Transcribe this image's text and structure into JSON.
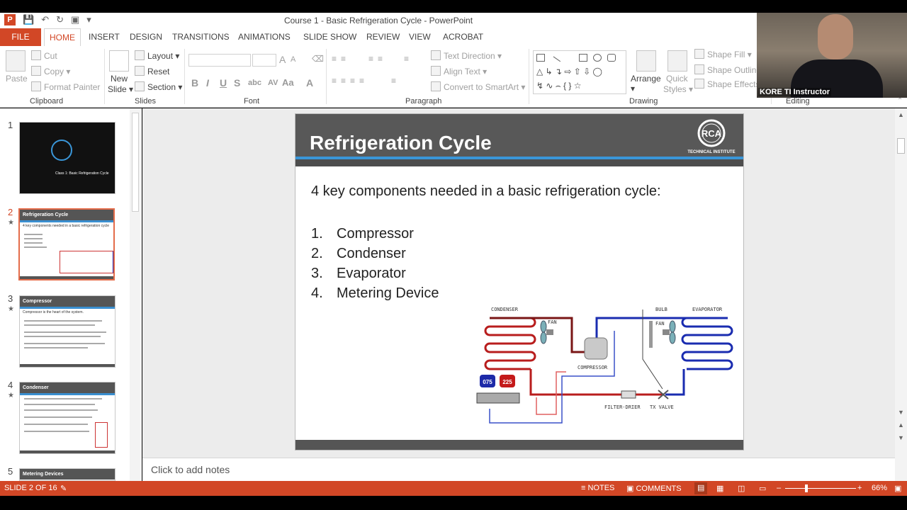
{
  "window": {
    "title": "Course 1 - Basic Refrigeration Cycle - PowerPoint"
  },
  "tabs": [
    "FILE",
    "HOME",
    "INSERT",
    "DESIGN",
    "TRANSITIONS",
    "ANIMATIONS",
    "SLIDE SHOW",
    "REVIEW",
    "VIEW",
    "ACROBAT"
  ],
  "ribbon": {
    "clipboard": {
      "paste": "Paste",
      "cut": "Cut",
      "copy": "Copy",
      "format_painter": "Format Painter",
      "label": "Clipboard"
    },
    "slides": {
      "new_slide_line1": "New",
      "new_slide_line2": "Slide",
      "layout": "Layout",
      "reset": "Reset",
      "section": "Section",
      "label": "Slides"
    },
    "font": {
      "label": "Font",
      "bold": "B",
      "italic": "I",
      "underline": "U",
      "strike": "S",
      "shadow": "abc",
      "spacing": "AV",
      "case": "Aa",
      "color": "A",
      "grow": "A",
      "shrink": "A"
    },
    "paragraph": {
      "label": "Paragraph",
      "text_direction": "Text Direction",
      "align_text": "Align Text",
      "convert_smartart": "Convert to SmartArt"
    },
    "drawing": {
      "label": "Drawing",
      "arrange": "Arrange",
      "quick_styles_1": "Quick",
      "quick_styles_2": "Styles",
      "shape_fill": "Shape Fill",
      "shape_outline": "Shape Outline",
      "shape_effects": "Shape Effects"
    },
    "editing": {
      "label": "Editing"
    }
  },
  "webcam": {
    "label": "KORE TI Instructor"
  },
  "thumbnails": [
    {
      "num": "1",
      "title": "",
      "subtitle": "Class 1: Basic Refrigeration Cycle",
      "star": false
    },
    {
      "num": "2",
      "title": "Refrigeration Cycle",
      "subtitle": "4 key components needed in a basic refrigeration cycle",
      "star": true
    },
    {
      "num": "3",
      "title": "Compressor",
      "subtitle": "Compressor is the heart of the system.",
      "star": true
    },
    {
      "num": "4",
      "title": "Condenser",
      "subtitle": "",
      "star": true
    },
    {
      "num": "5",
      "title": "Metering Devices",
      "subtitle": "",
      "star": false
    }
  ],
  "slide": {
    "title": "Refrigeration Cycle",
    "logo": {
      "text": "RCA",
      "sub": "TECHNICAL INSTITUTE"
    },
    "intro": "4 key components needed in a basic refrigeration cycle:",
    "items": [
      {
        "n": "1.",
        "text": "Compressor"
      },
      {
        "n": "2.",
        "text": "Condenser"
      },
      {
        "n": "3.",
        "text": "Evaporator"
      },
      {
        "n": "4.",
        "text": "Metering Device"
      }
    ],
    "diagram": {
      "condenser": "CONDENSER",
      "bulb": "BULB",
      "evaporator": "EVAPORATOR",
      "fan_left": "FAN",
      "fan_right": "FAN",
      "compressor": "COMPRESSOR",
      "filter_drier": "FILTER-DRIER",
      "tx_valve": "TX VALVE",
      "gauge_low": "075",
      "gauge_high": "225"
    }
  },
  "notes": {
    "placeholder": "Click to add notes"
  },
  "status": {
    "slide_of": "SLIDE 2 OF 16",
    "notes": "NOTES",
    "comments": "COMMENTS",
    "zoom": "66%"
  },
  "colors": {
    "accent": "#d24726",
    "slide_header": "#585858",
    "slide_blue": "#3a96d8"
  }
}
